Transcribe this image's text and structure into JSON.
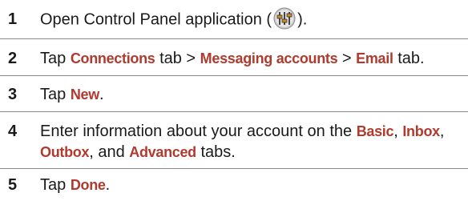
{
  "steps": [
    {
      "number": "1",
      "text_before": "Open Control Panel application (",
      "icon": "control-panel-sliders-icon",
      "text_after": ")."
    },
    {
      "number": "2",
      "t1": "Tap ",
      "h1": "Connections",
      "t2": " tab > ",
      "h2": "Messaging accounts",
      "t3": " > ",
      "h3": "Email",
      "t4": " tab."
    },
    {
      "number": "3",
      "t1": "Tap ",
      "h1": "New",
      "t2": "."
    },
    {
      "number": "4",
      "t1": "Enter information about your account on the ",
      "h1": "Basic",
      "t2": ", ",
      "h2": "Inbox",
      "t3": ",",
      "h3": "Outbox",
      "t4": ", and ",
      "h4": "Advanced",
      "t5": " tabs."
    },
    {
      "number": "5",
      "t1": "Tap ",
      "h1": "Done",
      "t2": "."
    }
  ],
  "colors": {
    "highlight": "#b13a2e",
    "separator": "#888888",
    "text": "#1a1a1a"
  }
}
